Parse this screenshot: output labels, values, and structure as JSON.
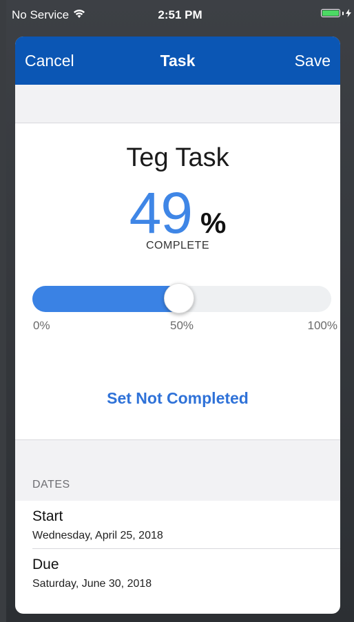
{
  "status_bar": {
    "carrier": "No Service",
    "time": "2:51 PM",
    "wifi_icon": "wifi-icon",
    "battery_icon": "battery-charging-icon"
  },
  "nav": {
    "cancel_label": "Cancel",
    "title": "Task",
    "save_label": "Save",
    "background_color": "#0b56b4"
  },
  "task": {
    "name": "Teg Task",
    "percent_value": "49",
    "percent_sign": "%",
    "complete_label": "COMPLETE",
    "progress_fraction": 0.49,
    "accent_color": "#3f86e6"
  },
  "slider": {
    "tick_0": "0%",
    "tick_50": "50%",
    "tick_100": "100%"
  },
  "actions": {
    "set_not_completed_label": "Set Not Completed"
  },
  "dates": {
    "section_header": "DATES",
    "start_title": "Start",
    "start_value": "Wednesday, April 25, 2018",
    "due_title": "Due",
    "due_value": "Saturday, June 30, 2018"
  }
}
